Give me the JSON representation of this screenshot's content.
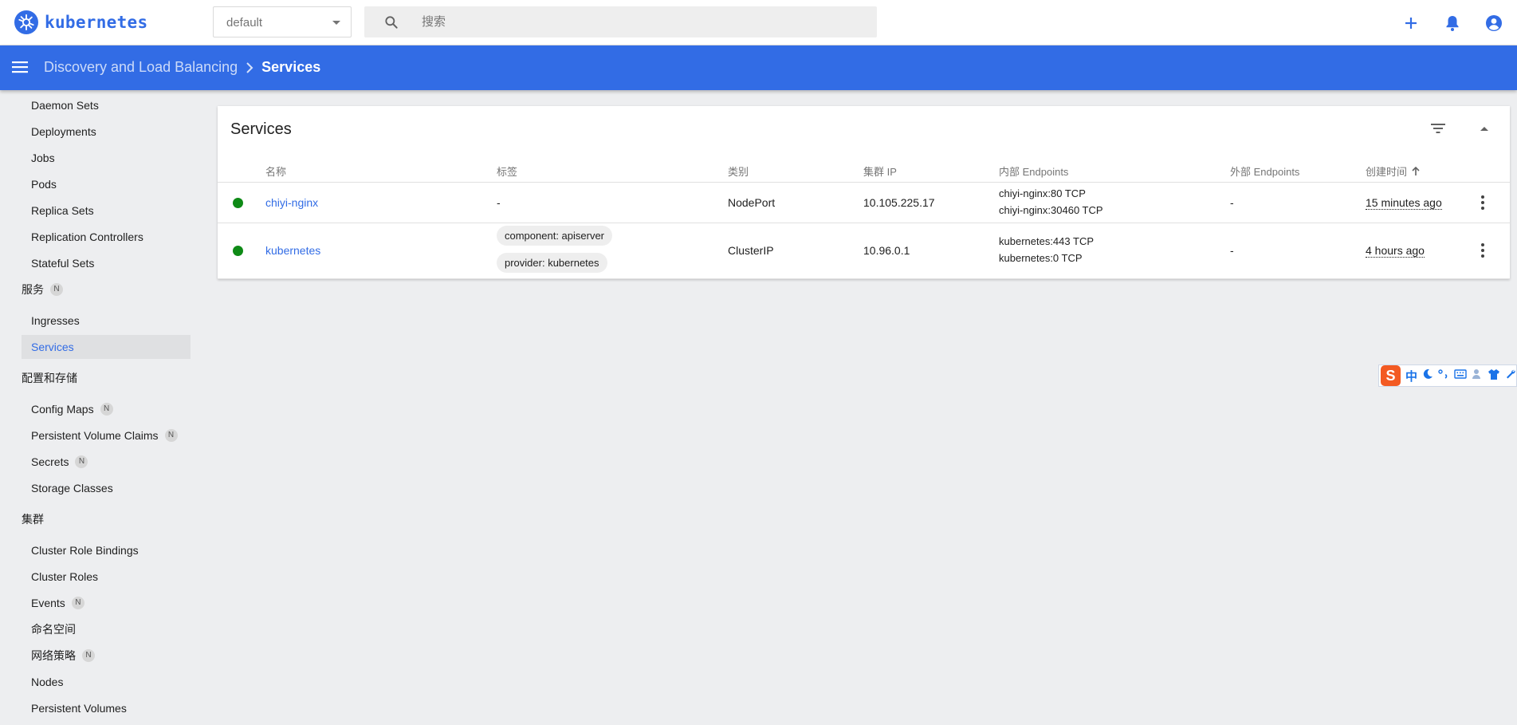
{
  "brand": {
    "name": "kubernetes"
  },
  "namespace": {
    "selected": "default"
  },
  "search": {
    "placeholder": "搜索"
  },
  "breadcrumb": {
    "parent": "Discovery and Load Balancing",
    "current": "Services"
  },
  "sidebar": {
    "workloads": [
      {
        "label": "Daemon Sets"
      },
      {
        "label": "Deployments"
      },
      {
        "label": "Jobs"
      },
      {
        "label": "Pods"
      },
      {
        "label": "Replica Sets"
      },
      {
        "label": "Replication Controllers"
      },
      {
        "label": "Stateful Sets"
      }
    ],
    "services_section": {
      "label": "服务",
      "badge": "N"
    },
    "services_items": [
      {
        "label": "Ingresses"
      },
      {
        "label": "Services"
      }
    ],
    "config_section": {
      "label": "配置和存储"
    },
    "config_items": [
      {
        "label": "Config Maps",
        "badge": "N"
      },
      {
        "label": "Persistent Volume Claims",
        "badge": "N"
      },
      {
        "label": "Secrets",
        "badge": "N"
      },
      {
        "label": "Storage Classes"
      }
    ],
    "cluster_section": {
      "label": "集群"
    },
    "cluster_items": [
      {
        "label": "Cluster Role Bindings"
      },
      {
        "label": "Cluster Roles"
      },
      {
        "label": "Events",
        "badge": "N"
      },
      {
        "label": "命名空间"
      },
      {
        "label": "网络策略",
        "badge": "N"
      },
      {
        "label": "Nodes"
      },
      {
        "label": "Persistent Volumes"
      }
    ]
  },
  "card": {
    "title": "Services",
    "columns": {
      "name": "名称",
      "labels": "标签",
      "type": "类别",
      "cluster_ip": "集群 IP",
      "internal_endpoints": "内部 Endpoints",
      "external_endpoints": "外部 Endpoints",
      "created": "创建时间"
    },
    "rows": [
      {
        "name": "chiyi-nginx",
        "labels": "-",
        "type": "NodePort",
        "cluster_ip": "10.105.225.17",
        "internal_endpoints": [
          "chiyi-nginx:80 TCP",
          "chiyi-nginx:30460 TCP"
        ],
        "external_endpoints": "-",
        "created": "15 minutes ago"
      },
      {
        "name": "kubernetes",
        "labels": [
          "component: apiserver",
          "provider: kubernetes"
        ],
        "type": "ClusterIP",
        "cluster_ip": "10.96.0.1",
        "internal_endpoints": [
          "kubernetes:443 TCP",
          "kubernetes:0 TCP"
        ],
        "external_endpoints": "-",
        "created": "4 hours ago"
      }
    ]
  },
  "ime": {
    "logo": "S",
    "mode": "中"
  },
  "colors": {
    "primary": "#326ce5",
    "status_ok": "#0e8a16",
    "background": "#edeef0"
  }
}
